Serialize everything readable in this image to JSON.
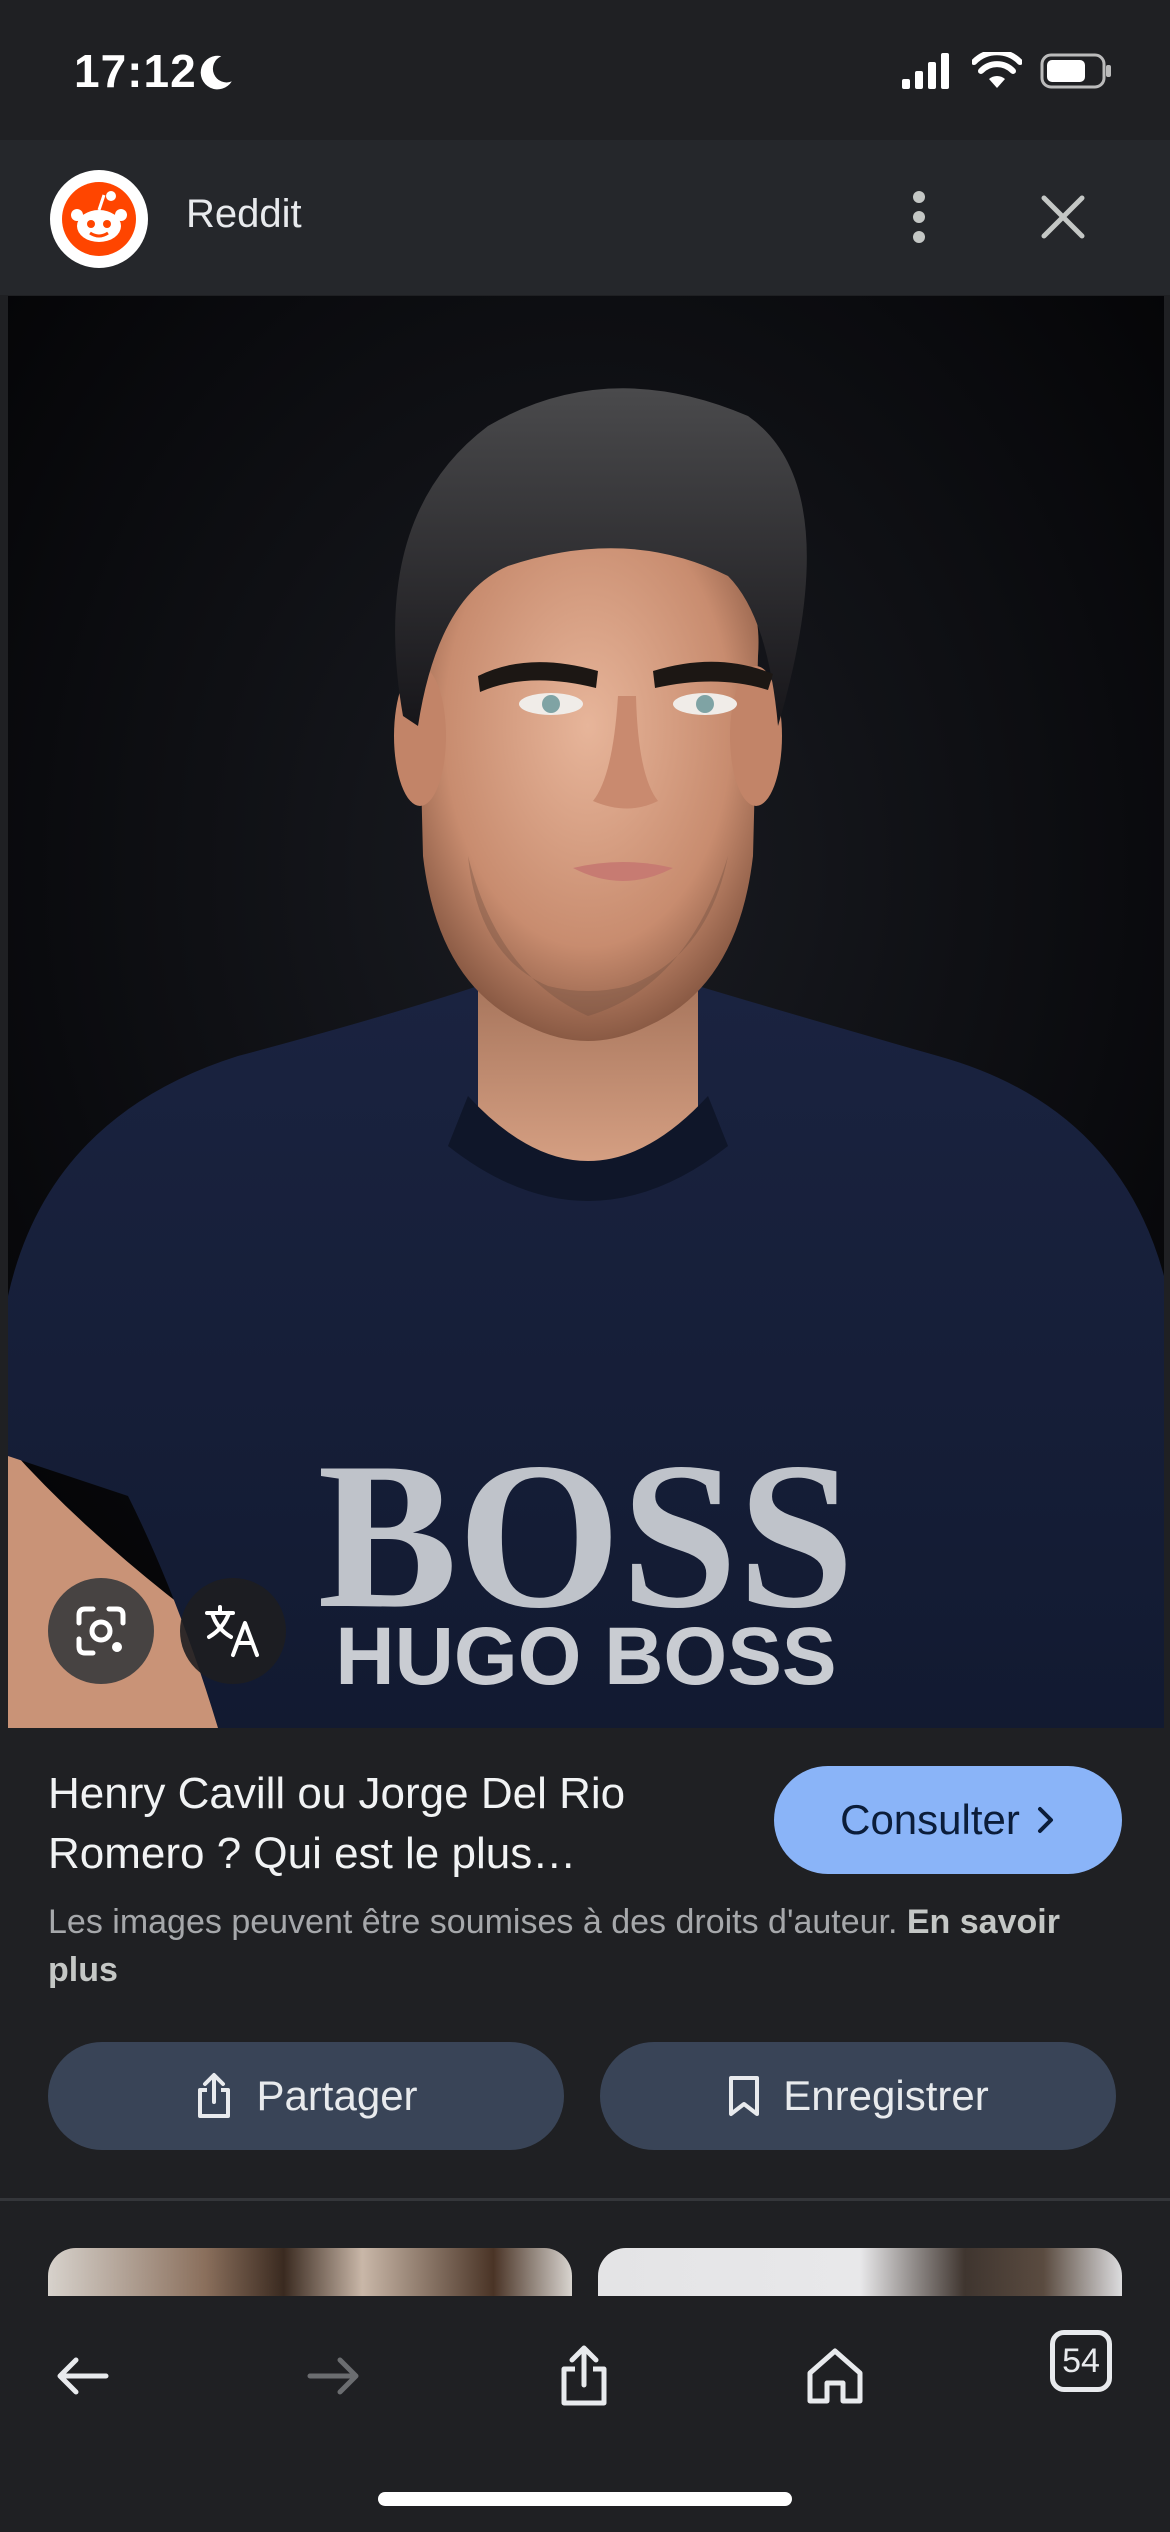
{
  "status_bar": {
    "time": "17:12",
    "icons": [
      "moon-icon",
      "signal-icon",
      "wifi-icon",
      "battery-icon"
    ]
  },
  "top_bar": {
    "site_name": "Reddit",
    "icons": [
      "reddit-logo",
      "more-vert-icon",
      "close-icon"
    ]
  },
  "image": {
    "description_icons": [
      "google-lens-icon",
      "translate-icon"
    ],
    "shirt_text_big": "BOSS",
    "shirt_text_small": "HUGO BOSS"
  },
  "result": {
    "title": "Henry Cavill ou Jorge Del Rio Romero ? Qui est le plus…",
    "visit_button": "Consulter",
    "copyright_text": "Les images peuvent être soumises à des droits d'auteur.",
    "learn_more": "En savoir plus"
  },
  "actions": {
    "share_label": "Partager",
    "save_label": "Enregistrer"
  },
  "bottom_bar": {
    "tabs_count": "54"
  },
  "colors": {
    "background": "#1f2023",
    "accent": "#8ab4f8",
    "button_bg": "#394457",
    "reddit_orange": "#ff4500"
  }
}
